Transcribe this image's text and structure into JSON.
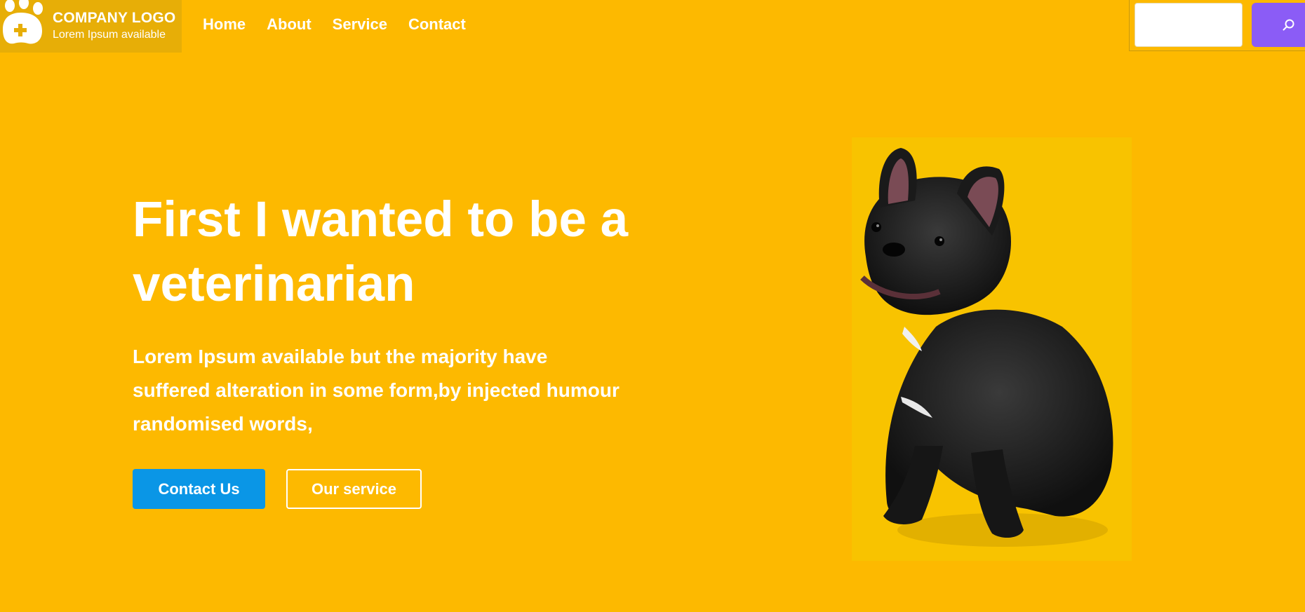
{
  "logo": {
    "title": "COMPANY LOGO",
    "subtitle": "Lorem Ipsum available",
    "icon": "paw-plus-icon"
  },
  "nav": {
    "items": [
      {
        "label": "Home"
      },
      {
        "label": "About"
      },
      {
        "label": "Service"
      },
      {
        "label": "Contact"
      }
    ]
  },
  "search": {
    "placeholder": "",
    "value": "",
    "icon": "search-icon",
    "button_color": "#8B5CF6"
  },
  "hero": {
    "title": "First I wanted to be a veterinarian",
    "text": "Lorem Ipsum available but the majority have suffered alteration in some form,by injected humour randomised words,",
    "primary_button": "Contact Us",
    "secondary_button": "Our service",
    "image": "french-bulldog-photo"
  },
  "colors": {
    "background": "#FDB900",
    "primary_button": "#0A96E6",
    "text": "#ffffff"
  }
}
